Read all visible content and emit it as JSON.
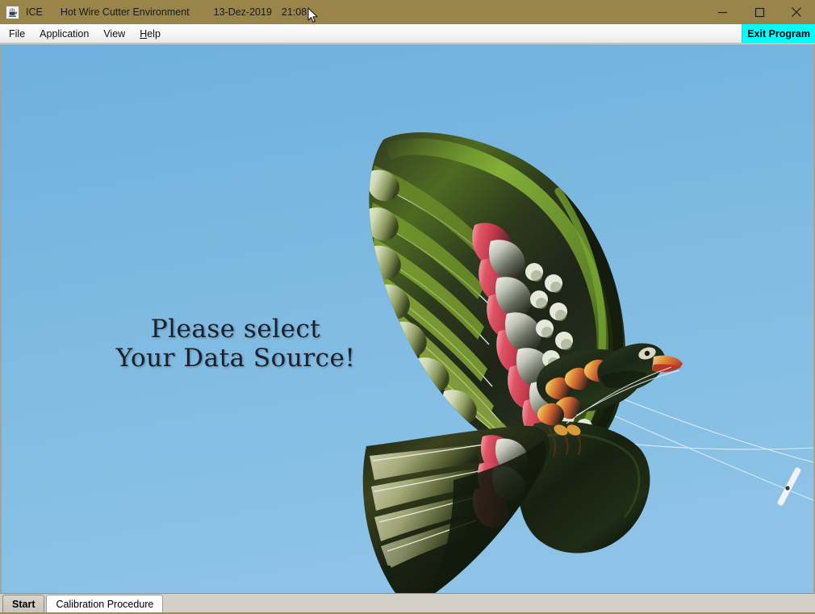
{
  "window": {
    "icon_name": "java-coffee-cup-icon",
    "app_name": "ICE",
    "description": "Hot Wire Cutter Environment",
    "date": "13-Dez-2019",
    "time": "21:08",
    "titlebar_color": "#99854A",
    "controls": {
      "minimize_label": "minimize-icon",
      "maximize_label": "maximize-icon",
      "close_label": "close-icon"
    },
    "cursor_name": "mouse-pointer-cursor"
  },
  "menu": {
    "items": [
      {
        "label": "File",
        "mnemonic": ""
      },
      {
        "label": "Application",
        "mnemonic": ""
      },
      {
        "label": "View",
        "mnemonic": ""
      },
      {
        "label": "Help",
        "mnemonic": "H"
      }
    ],
    "exit_button": {
      "label": "Exit Program",
      "background_color": "#00FFFF"
    }
  },
  "main": {
    "background_image_name": "bird-kite-in-blue-sky-photo",
    "sky_color": "#7CB8E2",
    "prompt": {
      "line1": "Please select",
      "line2": "Your Data Source!",
      "color": "#16202E"
    }
  },
  "tabs": {
    "items": [
      {
        "label": "Start",
        "selected": true
      },
      {
        "label": "Calibration Procedure",
        "selected": false
      }
    ]
  }
}
